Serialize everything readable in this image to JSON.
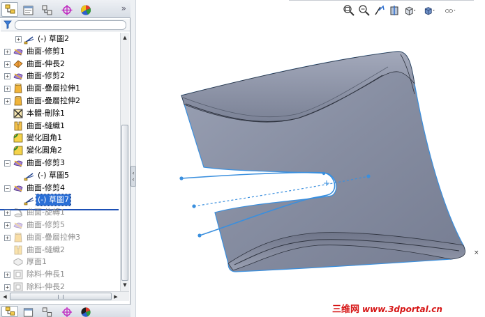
{
  "feature_manager": {
    "tabs": [
      {
        "icon": "feature-manager-tree-icon",
        "active": true
      },
      {
        "icon": "property-manager-icon",
        "active": false
      },
      {
        "icon": "configuration-manager-icon",
        "active": false
      },
      {
        "icon": "dimxpert-manager-icon",
        "active": false
      },
      {
        "icon": "display-manager-icon",
        "active": false
      }
    ],
    "collapse_label": "»",
    "filter_icon": "filter-funnel-icon",
    "tree": [
      {
        "label": "(-) 草圖2",
        "icon": "sketch-icon",
        "expander": "+",
        "level": 1,
        "state": "normal"
      },
      {
        "label": "曲面-修剪1",
        "icon": "surface-trim-icon",
        "expander": "+",
        "level": 0,
        "state": "normal"
      },
      {
        "label": "曲面-伸長2",
        "icon": "surface-extend-icon",
        "expander": "+",
        "level": 0,
        "state": "normal"
      },
      {
        "label": "曲面-修剪2",
        "icon": "surface-trim-icon",
        "expander": "+",
        "level": 0,
        "state": "normal"
      },
      {
        "label": "曲面-疊層拉伸1",
        "icon": "surface-loft-icon",
        "expander": "+",
        "level": 0,
        "state": "normal"
      },
      {
        "label": "曲面-疊層拉伸2",
        "icon": "surface-loft-icon",
        "expander": "+",
        "level": 0,
        "state": "normal"
      },
      {
        "label": "本體-刪除1",
        "icon": "delete-body-icon",
        "expander": "",
        "level": 0,
        "state": "normal"
      },
      {
        "label": "曲面-縫織1",
        "icon": "surface-knit-icon",
        "expander": "",
        "level": 0,
        "state": "normal"
      },
      {
        "label": "變化圓角1",
        "icon": "variable-fillet-icon",
        "expander": "",
        "level": 0,
        "state": "normal"
      },
      {
        "label": "變化圓角2",
        "icon": "variable-fillet-icon",
        "expander": "",
        "level": 0,
        "state": "normal"
      },
      {
        "label": "曲面-修剪3",
        "icon": "surface-trim-icon",
        "expander": "−",
        "level": 0,
        "state": "normal"
      },
      {
        "label": "(-) 草圖5",
        "icon": "sketch-icon",
        "expander": "",
        "level": 1,
        "state": "normal"
      },
      {
        "label": "曲面-修剪4",
        "icon": "surface-trim-icon",
        "expander": "−",
        "level": 0,
        "state": "normal"
      },
      {
        "label": "(-) 草圖7",
        "icon": "sketch-icon",
        "expander": "",
        "level": 1,
        "state": "selected"
      },
      {
        "label": "曲面-旋轉1",
        "icon": "surface-revolve-icon",
        "expander": "+",
        "level": 0,
        "state": "suppressed"
      },
      {
        "label": "曲面-修剪5",
        "icon": "surface-trim-icon",
        "expander": "+",
        "level": 0,
        "state": "suppressed"
      },
      {
        "label": "曲面-疊層拉伸3",
        "icon": "surface-loft-icon",
        "expander": "+",
        "level": 0,
        "state": "suppressed"
      },
      {
        "label": "曲面-縫織2",
        "icon": "surface-knit-icon",
        "expander": "",
        "level": 0,
        "state": "suppressed"
      },
      {
        "label": "厚面1",
        "icon": "thicken-icon",
        "expander": "",
        "level": 0,
        "state": "suppressed"
      },
      {
        "label": "除料-伸長1",
        "icon": "extruded-cut-icon",
        "expander": "+",
        "level": 0,
        "state": "suppressed"
      },
      {
        "label": "除料-伸長2",
        "icon": "extruded-cut-icon",
        "expander": "+",
        "level": 0,
        "state": "suppressed"
      }
    ]
  },
  "view_toolbar": [
    {
      "icon": "zoom-to-fit-icon"
    },
    {
      "icon": "zoom-to-area-icon"
    },
    {
      "icon": "previous-view-icon"
    },
    {
      "icon": "section-view-icon"
    },
    {
      "icon": "view-orientation-icon"
    },
    {
      "icon": "display-style-icon"
    },
    {
      "icon": "hide-show-items-icon"
    }
  ],
  "model": {
    "color": "#8e95a8",
    "edge_color": "#2f3440",
    "highlight_color": "#3a8fde"
  },
  "watermark": {
    "brand": "三维网",
    "url": "www.3dportal.cn"
  },
  "viewport_close": "×"
}
